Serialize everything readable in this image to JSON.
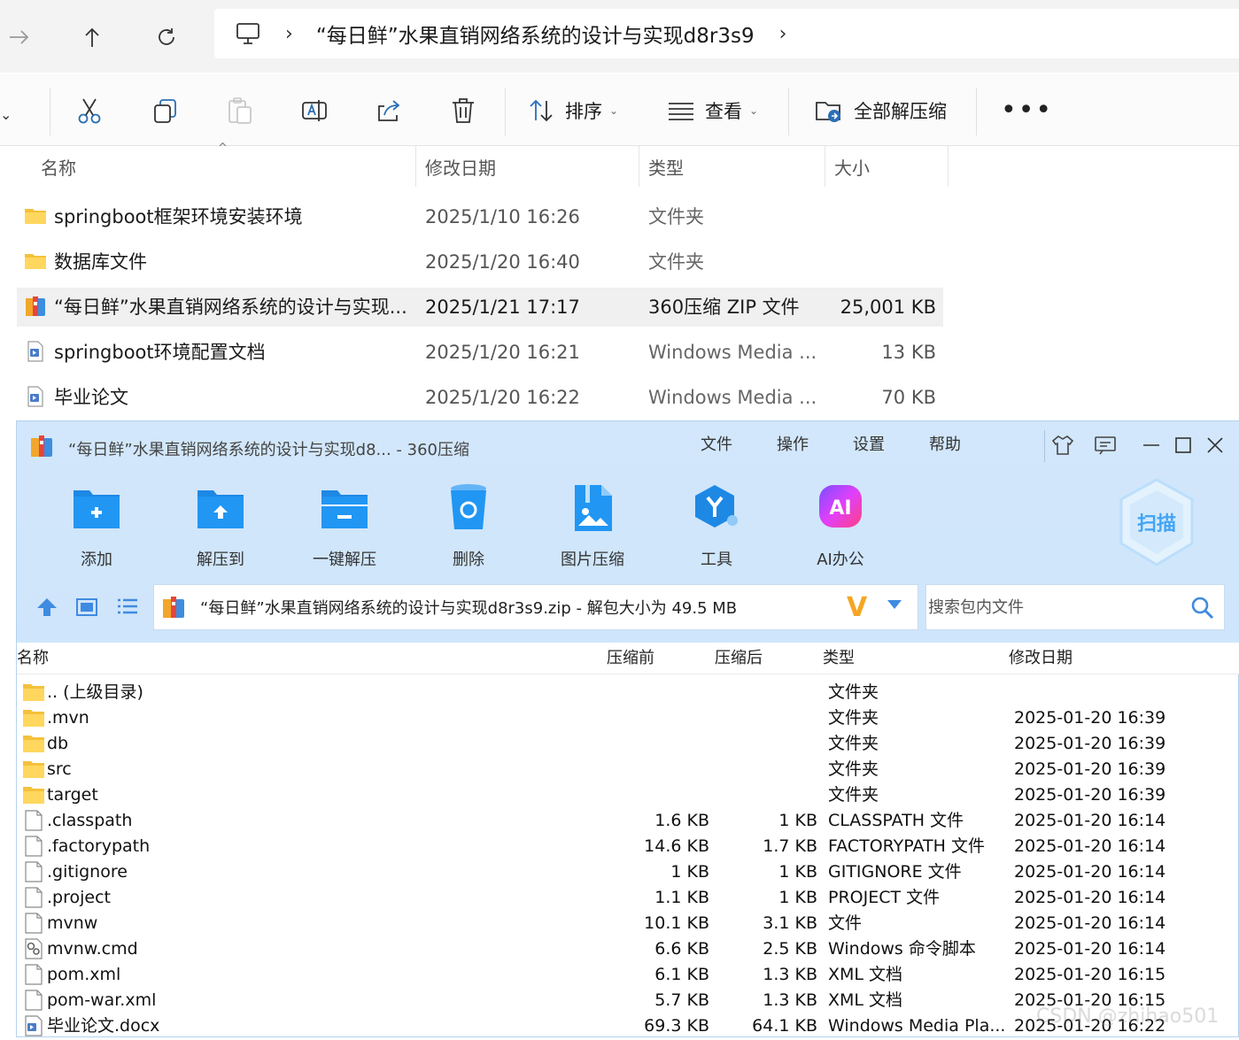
{
  "explorer": {
    "address": {
      "crumb": "“每日鲜”水果直销网络系统的设计与实现d8r3s9"
    },
    "commands": {
      "sort_label": "排序",
      "view_label": "查看",
      "extract_all_label": "全部解压缩"
    },
    "columns": {
      "name": "名称",
      "modified": "修改日期",
      "type": "类型",
      "size": "大小"
    },
    "rows": [
      {
        "name": "springboot框架环境安装环境",
        "date": "2025/1/10 16:26",
        "type": "文件夹",
        "size": "",
        "icon": "folder-icon"
      },
      {
        "name": "数据库文件",
        "date": "2025/1/20 16:40",
        "type": "文件夹",
        "size": "",
        "icon": "folder-icon"
      },
      {
        "name": "“每日鲜”水果直销网络系统的设计与实现...",
        "date": "2025/1/21 17:17",
        "type": "360压缩 ZIP 文件",
        "size": "25,001 KB",
        "icon": "zip-archive-icon"
      },
      {
        "name": "springboot环境配置文档",
        "date": "2025/1/20 16:21",
        "type": "Windows Media ...",
        "size": "13 KB",
        "icon": "document-icon"
      },
      {
        "name": "毕业论文",
        "date": "2025/1/20 16:22",
        "type": "Windows Media ...",
        "size": "70 KB",
        "icon": "document-icon"
      }
    ]
  },
  "zip_window": {
    "title": "“每日鲜”水果直销网络系统的设计与实现d8... - 360压缩",
    "menu": [
      "文件",
      "操作",
      "设置",
      "帮助"
    ],
    "tools": [
      {
        "label": "添加",
        "icon": "add-folder-icon"
      },
      {
        "label": "解压到",
        "icon": "extract-to-icon"
      },
      {
        "label": "一键解压",
        "icon": "one-click-extract-icon"
      },
      {
        "label": "删除",
        "icon": "delete-bin-icon"
      },
      {
        "label": "图片压缩",
        "icon": "image-compress-icon"
      },
      {
        "label": "工具",
        "icon": "tools-icon"
      },
      {
        "label": "AI办公",
        "icon": "ai-office-icon"
      }
    ],
    "scan_label": "扫描",
    "path_text": "“每日鲜”水果直销网络系统的设计与实现d8r3s9.zip - 解包大小为 49.5 MB",
    "search_placeholder": "搜索包内文件",
    "columns": {
      "name": "名称",
      "before": "压缩前",
      "after": "压缩后",
      "type": "类型",
      "date": "修改日期"
    },
    "rows": [
      {
        "name": ".. (上级目录)",
        "pre": "",
        "post": "",
        "type": "文件夹",
        "date": "",
        "icon": "folder-icon"
      },
      {
        "name": ".mvn",
        "pre": "",
        "post": "",
        "type": "文件夹",
        "date": "2025-01-20 16:39",
        "icon": "folder-icon"
      },
      {
        "name": "db",
        "pre": "",
        "post": "",
        "type": "文件夹",
        "date": "2025-01-20 16:39",
        "icon": "folder-icon"
      },
      {
        "name": "src",
        "pre": "",
        "post": "",
        "type": "文件夹",
        "date": "2025-01-20 16:39",
        "icon": "folder-icon"
      },
      {
        "name": "target",
        "pre": "",
        "post": "",
        "type": "文件夹",
        "date": "2025-01-20 16:39",
        "icon": "folder-icon"
      },
      {
        "name": ".classpath",
        "pre": "1.6 KB",
        "post": "1 KB",
        "type": "CLASSPATH 文件",
        "date": "2025-01-20 16:14",
        "icon": "file-icon"
      },
      {
        "name": ".factorypath",
        "pre": "14.6 KB",
        "post": "1.7 KB",
        "type": "FACTORYPATH 文件",
        "date": "2025-01-20 16:14",
        "icon": "file-icon"
      },
      {
        "name": ".gitignore",
        "pre": "1 KB",
        "post": "1 KB",
        "type": "GITIGNORE 文件",
        "date": "2025-01-20 16:14",
        "icon": "file-icon"
      },
      {
        "name": ".project",
        "pre": "1.1 KB",
        "post": "1 KB",
        "type": "PROJECT 文件",
        "date": "2025-01-20 16:14",
        "icon": "file-icon"
      },
      {
        "name": "mvnw",
        "pre": "10.1 KB",
        "post": "3.1 KB",
        "type": "文件",
        "date": "2025-01-20 16:14",
        "icon": "file-icon"
      },
      {
        "name": "mvnw.cmd",
        "pre": "6.6 KB",
        "post": "2.5 KB",
        "type": "Windows 命令脚本",
        "date": "2025-01-20 16:14",
        "icon": "script-icon"
      },
      {
        "name": "pom.xml",
        "pre": "6.1 KB",
        "post": "1.3 KB",
        "type": "XML 文档",
        "date": "2025-01-20 16:15",
        "icon": "file-icon"
      },
      {
        "name": "pom-war.xml",
        "pre": "5.7 KB",
        "post": "1.3 KB",
        "type": "XML 文档",
        "date": "2025-01-20 16:15",
        "icon": "file-icon"
      },
      {
        "name": "毕业论文.docx",
        "pre": "69.3 KB",
        "post": "64.1 KB",
        "type": "Windows Media Pla...",
        "date": "2025-01-20 16:22",
        "icon": "document-icon"
      }
    ]
  },
  "watermark": "CSDN @zhihao501"
}
